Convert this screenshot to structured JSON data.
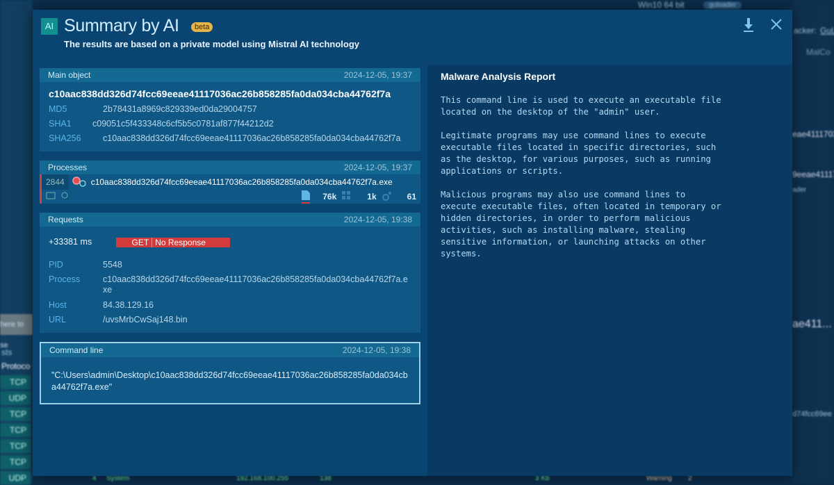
{
  "background": {
    "os": "Win10 64 bit",
    "tag": "guloader",
    "tracker": "acker:",
    "tracker_link": "GuL",
    "malco": "MalCo",
    "left_search": "here to se",
    "left_tab": "sts",
    "left_header": "Protoco",
    "protocols": [
      "TCP",
      "UDP",
      "TCP",
      "TCP",
      "TCP",
      "TCP",
      "UDP"
    ],
    "right_hash1": "eae4111703",
    "right_hash2": "9eeae41117",
    "right_hash3": "ae411...",
    "right_hash4": "d74fcc69ee",
    "right_tag": "ader",
    "bottom_row": {
      "pid": "4",
      "name": "System",
      "ip": "192.168.100.255",
      "port": "138",
      "size": "3 Kb",
      "warning": "Warning",
      "warning_count": "2"
    }
  },
  "modal": {
    "badge": "AI",
    "title": "Summary by AI",
    "beta": "beta",
    "subtitle": "The results are based on a private model using Mistral AI technology",
    "main_object": {
      "label": "Main object",
      "timestamp": "2024-12-05, 19:37",
      "name": "c10aac838dd326d74fcc69eeae41117036ac26b858285fa0da034cba44762f7a",
      "md5_label": "MD5",
      "md5": "2b78431a8969c829339ed0da29004757",
      "sha1_label": "SHA1",
      "sha1": "c09051c5f433348c6cf5b5c0781af877f44212d2",
      "sha256_label": "SHA256",
      "sha256": "c10aac838dd326d74fcc69eeae41117036ac26b858285fa0da034cba44762f7a"
    },
    "processes": {
      "label": "Processes",
      "timestamp": "2024-12-05, 19:37",
      "pid": "2844",
      "name": "c10aac838dd326d74fcc69eeae41117036ac26b858285fa0da034cba44762f7a.exe",
      "files": "76k",
      "registry": "1k",
      "modules": "61"
    },
    "requests": {
      "label": "Requests",
      "timestamp": "2024-12-05, 19:38",
      "time": "+33381 ms",
      "method": "GET",
      "status": "No Response",
      "pid_label": "PID",
      "pid": "5548",
      "process_label": "Process",
      "process": "c10aac838dd326d74fcc69eeae41117036ac26b858285fa0da034cba44762f7a.exe",
      "host_label": "Host",
      "host": "84.38.129.16",
      "url_label": "URL",
      "url": "/uvsMrbCwSaj148.bin"
    },
    "command_line": {
      "label": "Command line",
      "timestamp": "2024-12-05, 19:38",
      "text": "\"C:\\Users\\admin\\Desktop\\c10aac838dd326d74fcc69eeae41117036ac26b858285fa0da034cba44762f7a.exe\""
    },
    "report": {
      "title": "Malware Analysis Report",
      "paragraphs": [
        "This command line is used to execute an executable file\nlocated on the desktop of the \"admin\" user.",
        "Legitimate programs may use command lines to execute\nexecutable files located in specific directories, such\nas the desktop, for various purposes, such as running\napplications or scripts.",
        "Malicious programs may also use command lines to\nexecute executable files, often located in temporary or\nhidden directories, in order to perform malicious\nactivities, such as installing malware, stealing\nsensitive information, or launching attacks on other\nsystems."
      ]
    }
  }
}
